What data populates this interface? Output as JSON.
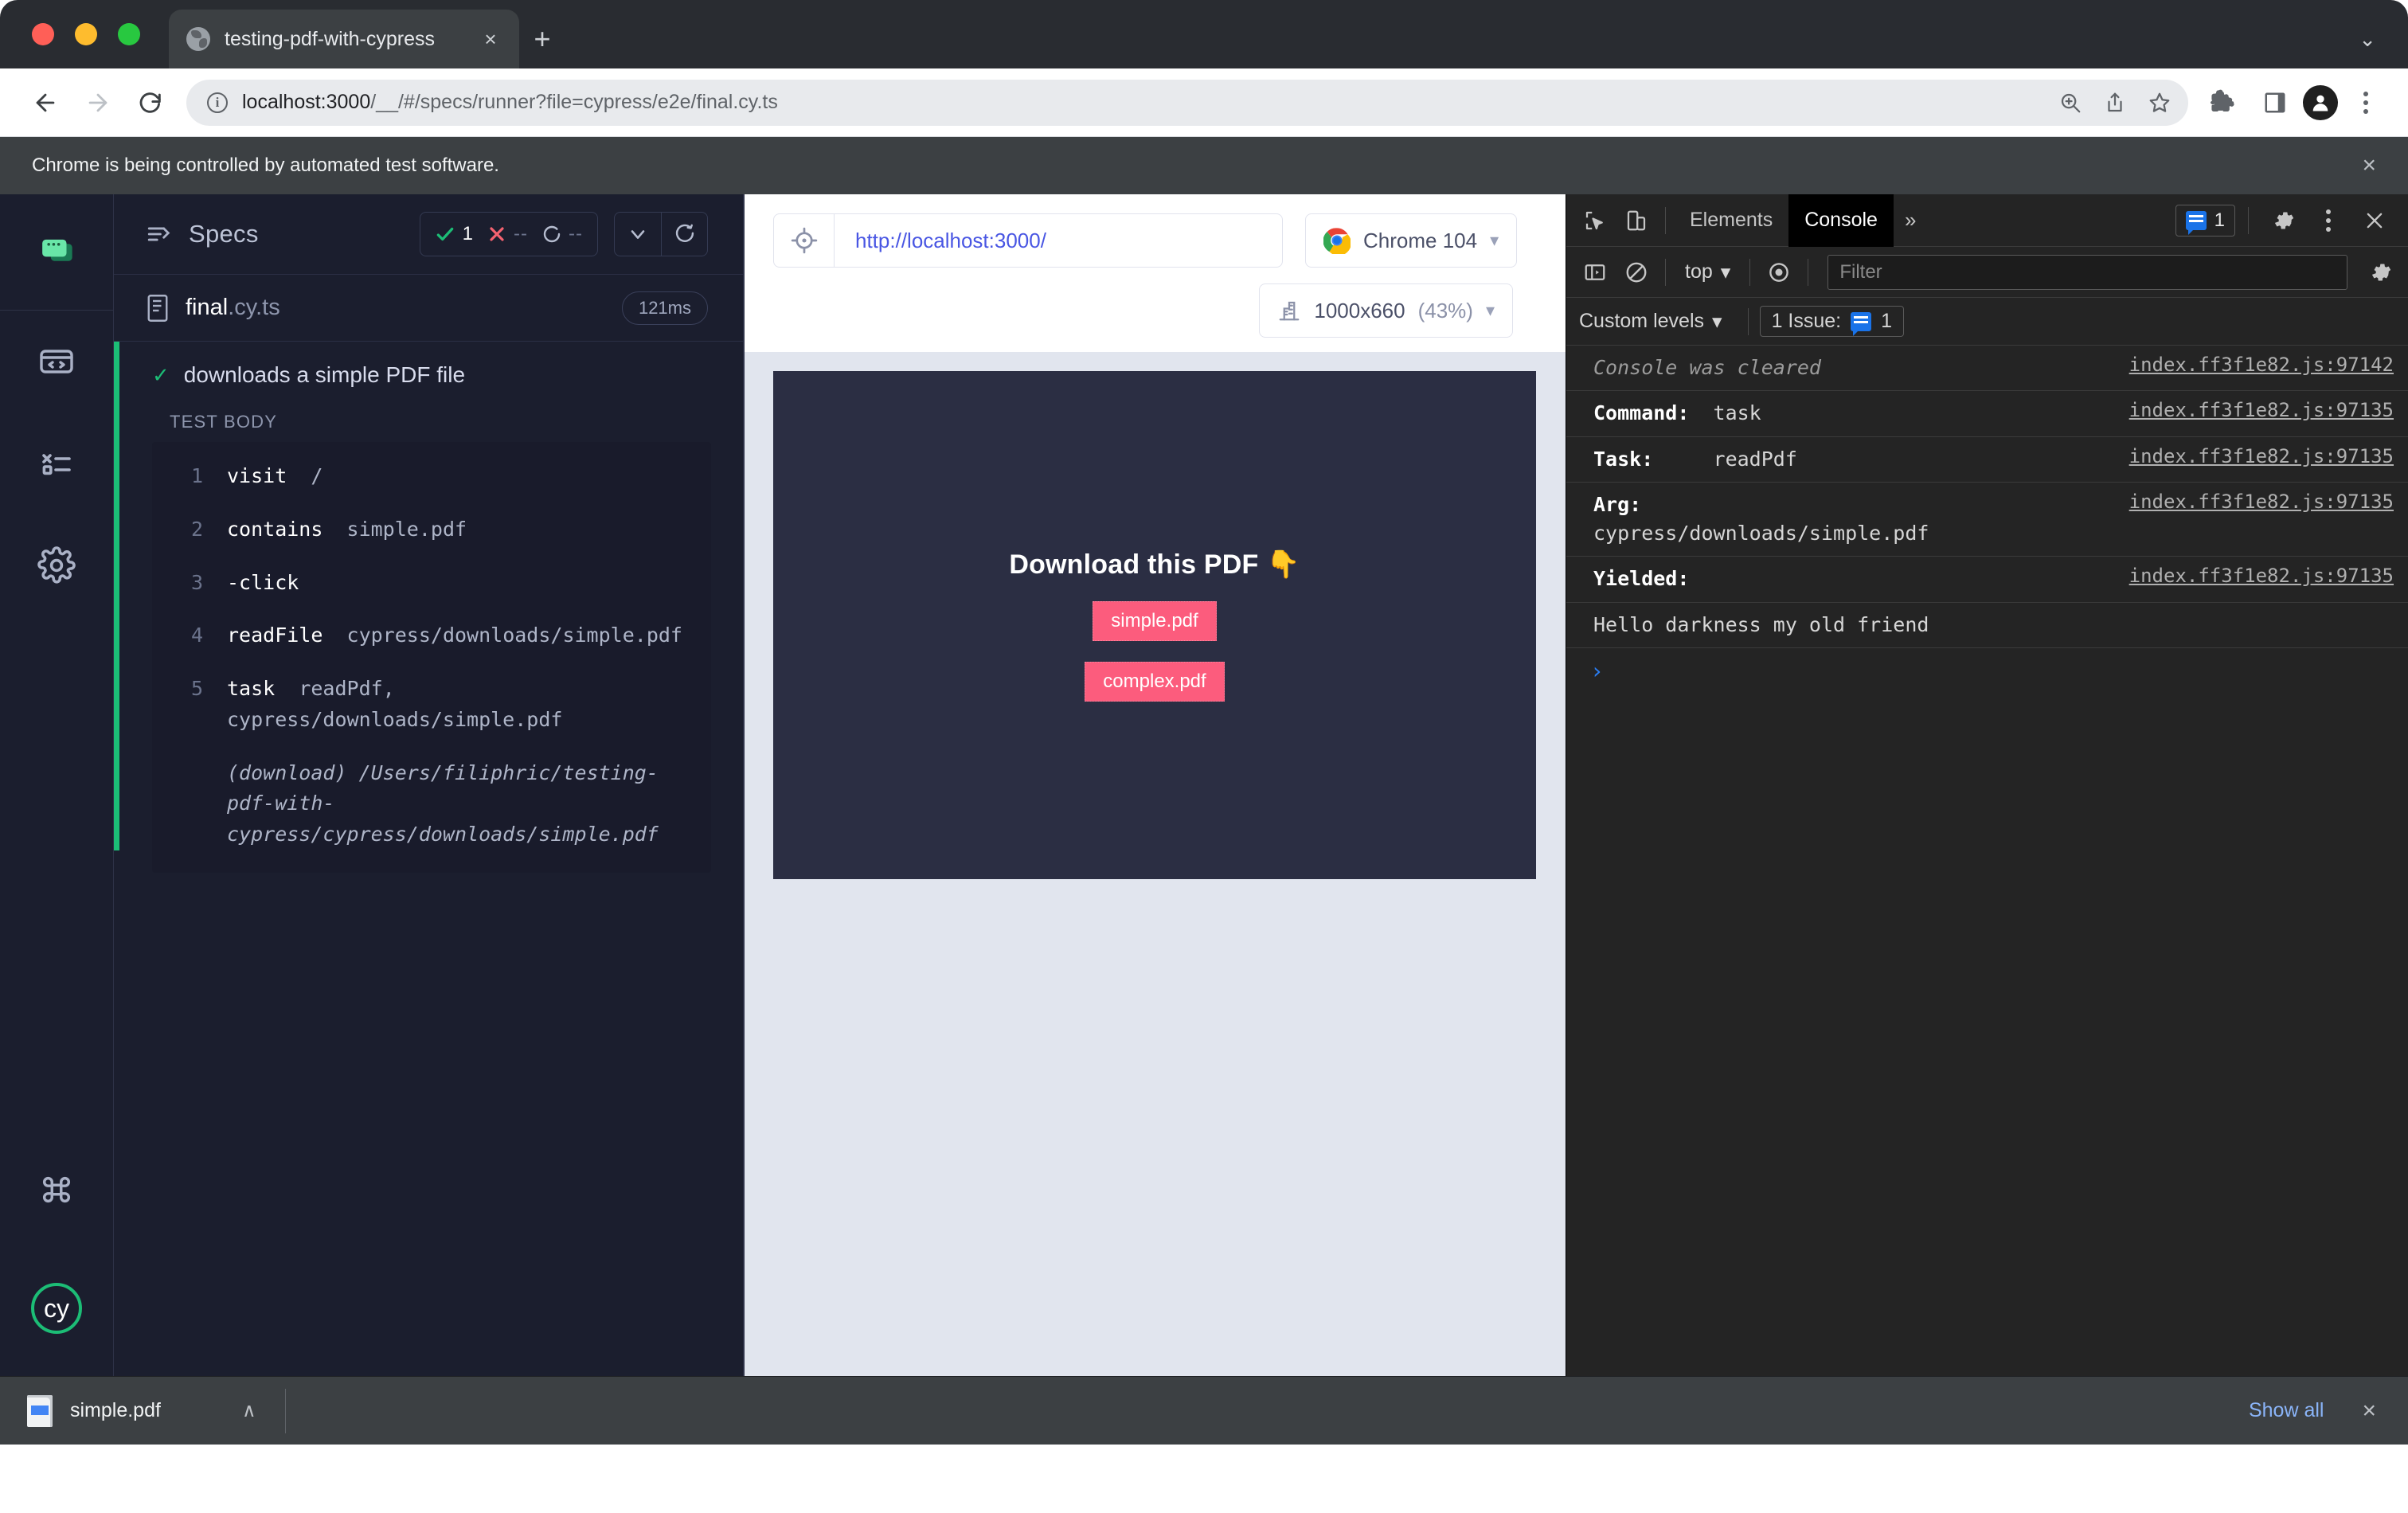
{
  "browser": {
    "window_controls": [
      "close",
      "minimize",
      "maximize"
    ],
    "tab": {
      "title": "testing-pdf-with-cypress",
      "close_label": "×",
      "favicon": "globe-icon"
    },
    "new_tab_label": "+",
    "window_expand_label": "⌄",
    "omnibox": {
      "url_host": "localhost:3000",
      "url_path": "/__/#/specs/runner?file=cypress/e2e/final.cy.ts",
      "info_icon": "ⓘ"
    },
    "infobar": {
      "message": "Chrome is being controlled by automated test software.",
      "close_label": "×"
    }
  },
  "rail": {
    "items": [
      {
        "name": "specs-icon",
        "label": "Specs"
      },
      {
        "name": "code-icon",
        "label": "Runs"
      },
      {
        "name": "debug-icon",
        "label": "Debug"
      },
      {
        "name": "settings-icon",
        "label": "Settings"
      },
      {
        "name": "shortcuts-icon",
        "label": "Keyboard Shortcuts"
      },
      {
        "name": "cypress-logo",
        "label": "cy"
      }
    ],
    "logo_text": "cy"
  },
  "reporter": {
    "header_label": "Specs",
    "stats": [
      {
        "icon": "check",
        "value": "1",
        "color": "#1cbd76"
      },
      {
        "icon": "times",
        "value": "--",
        "color": "#f56270"
      },
      {
        "icon": "circle",
        "value": "--",
        "color": "#b6bdd0"
      }
    ],
    "controls": [
      {
        "name": "collapse-button",
        "glyph": "chevron-down-icon"
      },
      {
        "name": "rerun-button",
        "glyph": "restart-icon"
      }
    ],
    "spec": {
      "name": "final",
      "ext": ".cy.ts",
      "duration": "121ms"
    },
    "test": {
      "status_glyph": "✓",
      "title": "downloads a simple PDF file",
      "body_label": "TEST BODY"
    },
    "commands": [
      {
        "num": "1",
        "name": "visit",
        "arg": "/"
      },
      {
        "num": "2",
        "name": "contains",
        "arg": "simple.pdf"
      },
      {
        "num": "3",
        "name": "-click",
        "arg": ""
      },
      {
        "num": "4",
        "name": "readFile",
        "arg": "cypress/downloads/simple.pdf"
      },
      {
        "num": "5",
        "name": "task",
        "arg": "readPdf, cypress/downloads/simple.pdf"
      }
    ],
    "download_note": "(download) /Users/filiphric/testing-pdf-with-cypress/cypress/downloads/simple.pdf"
  },
  "preview": {
    "selector_icon": "selector-playground-icon",
    "url": "http://localhost:3000/",
    "browser": {
      "name": "Chrome 104",
      "icon": "chrome-icon"
    },
    "viewport": {
      "label": "1000x660",
      "scale": "(43%)",
      "icon": "ruler-icon"
    },
    "app": {
      "heading": "Download this PDF",
      "emoji": "👇",
      "buttons": [
        {
          "label": "simple.pdf"
        },
        {
          "label": "complex.pdf"
        }
      ],
      "bg_color": "#2b2e43",
      "button_color": "#fc5c7d"
    }
  },
  "devtools": {
    "tabs": [
      {
        "label": "Elements",
        "active": false
      },
      {
        "label": "Console",
        "active": true
      }
    ],
    "more_label": "»",
    "icons": {
      "inspect": "inspect-element-icon",
      "device": "device-toolbar-icon",
      "settings": "gear-icon",
      "kebab": "more-options-icon",
      "close": "close-icon"
    },
    "issues_count": "1",
    "toolbar": {
      "sidebar_label": "console-sidebar-icon",
      "clear_label": "clear-console-icon",
      "context": "top",
      "eye_label": "live-expression-icon",
      "filter_placeholder": "Filter",
      "settings_label": "console-settings-icon"
    },
    "levels": {
      "label": "Custom levels",
      "issue_label": "1 Issue:",
      "issue_count": "1"
    },
    "log": [
      {
        "text": "Console was cleared",
        "style": "dim",
        "src": "index.ff3f1e82.js:97142"
      },
      {
        "key": "Command:",
        "text": "task",
        "src": "index.ff3f1e82.js:97135"
      },
      {
        "key": "Task:",
        "text": "readPdf",
        "src": "index.ff3f1e82.js:97135"
      },
      {
        "key": "Arg:",
        "text": "cypress/downloads/simple.pdf",
        "src": "index.ff3f1e82.js:97135",
        "wrap": true
      },
      {
        "key": "Yielded:",
        "text": "",
        "src": "index.ff3f1e82.js:97135"
      },
      {
        "text": "Hello darkness my old friend",
        "src": ""
      }
    ],
    "prompt": "›"
  },
  "download_shelf": {
    "file": {
      "name": "simple.pdf",
      "icon": "pdf-file-icon"
    },
    "caret": "∧",
    "show_all_label": "Show all",
    "close_label": "×"
  }
}
